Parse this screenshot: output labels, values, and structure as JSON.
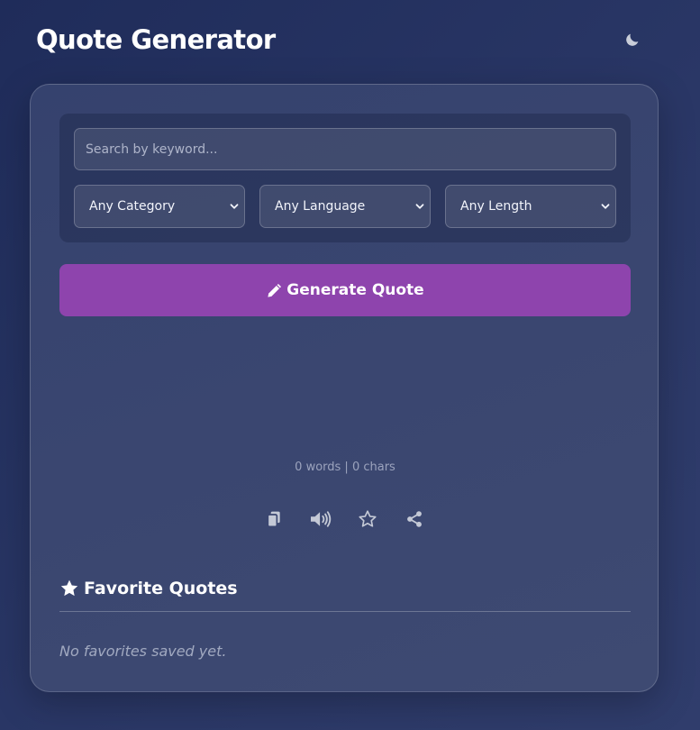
{
  "app": {
    "title": "Quote Generator",
    "theme_icon": "moon-icon"
  },
  "filters": {
    "search_placeholder": "Search by keyword...",
    "search_value": "",
    "category": "Any Category",
    "language": "Any Language",
    "length": "Any Length"
  },
  "generate": {
    "label": "Generate Quote",
    "icon": "pencil-icon"
  },
  "quote": {
    "text": "",
    "author": "",
    "stats": "0 words | 0 chars"
  },
  "actions": [
    {
      "name": "copy",
      "icon": "copy-icon"
    },
    {
      "name": "speak",
      "icon": "speaker-icon"
    },
    {
      "name": "favorite",
      "icon": "star-outline-icon"
    },
    {
      "name": "share",
      "icon": "share-icon"
    }
  ],
  "favorites": {
    "title": "Favorite Quotes",
    "icon": "star-icon",
    "empty_message": "No favorites saved yet.",
    "items": []
  },
  "colors": {
    "accent": "#8e44ad",
    "background": "#243063",
    "card": "#3a4670"
  }
}
